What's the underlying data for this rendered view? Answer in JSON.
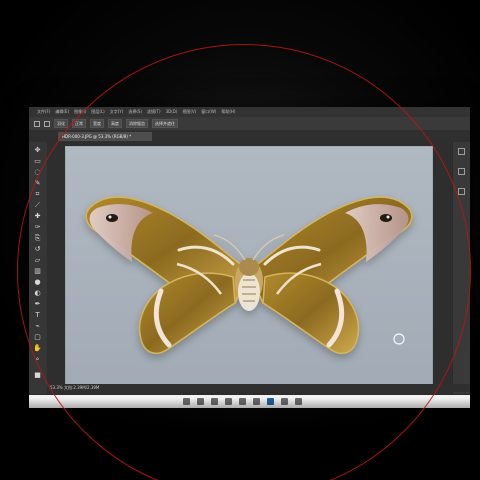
{
  "app": {
    "document_tab": "HDR-000-3.JPG @ 53.3% (RGB/8) *",
    "status_text": "53.3%  文档:2.39M/2.39M"
  },
  "menu": {
    "items": [
      "文件(F)",
      "编辑(E)",
      "图像(I)",
      "图层(L)",
      "文字(Y)",
      "选择(S)",
      "滤镜(T)",
      "3D(D)",
      "视图(V)",
      "窗口(W)",
      "帮助(H)"
    ]
  },
  "options": {
    "chips": [
      "羽化",
      "正常",
      "宽度",
      "高度",
      "消除锯齿",
      "选择并遮住"
    ]
  },
  "tools": {
    "icons": [
      "move-icon",
      "marquee-icon",
      "lasso-icon",
      "quick-select-icon",
      "crop-icon",
      "eyedropper-icon",
      "heal-icon",
      "brush-icon",
      "clone-icon",
      "history-icon",
      "eraser-icon",
      "gradient-icon",
      "blur-icon",
      "dodge-icon",
      "pen-icon",
      "text-icon",
      "path-icon",
      "shape-icon",
      "hand-icon",
      "zoom-icon"
    ]
  },
  "taskbar": {
    "icons": [
      "windows-icon",
      "search-icon",
      "taskview-icon",
      "explorer-icon",
      "browser-icon",
      "store-icon",
      "ps-icon",
      "mail-icon",
      "settings-icon"
    ]
  }
}
